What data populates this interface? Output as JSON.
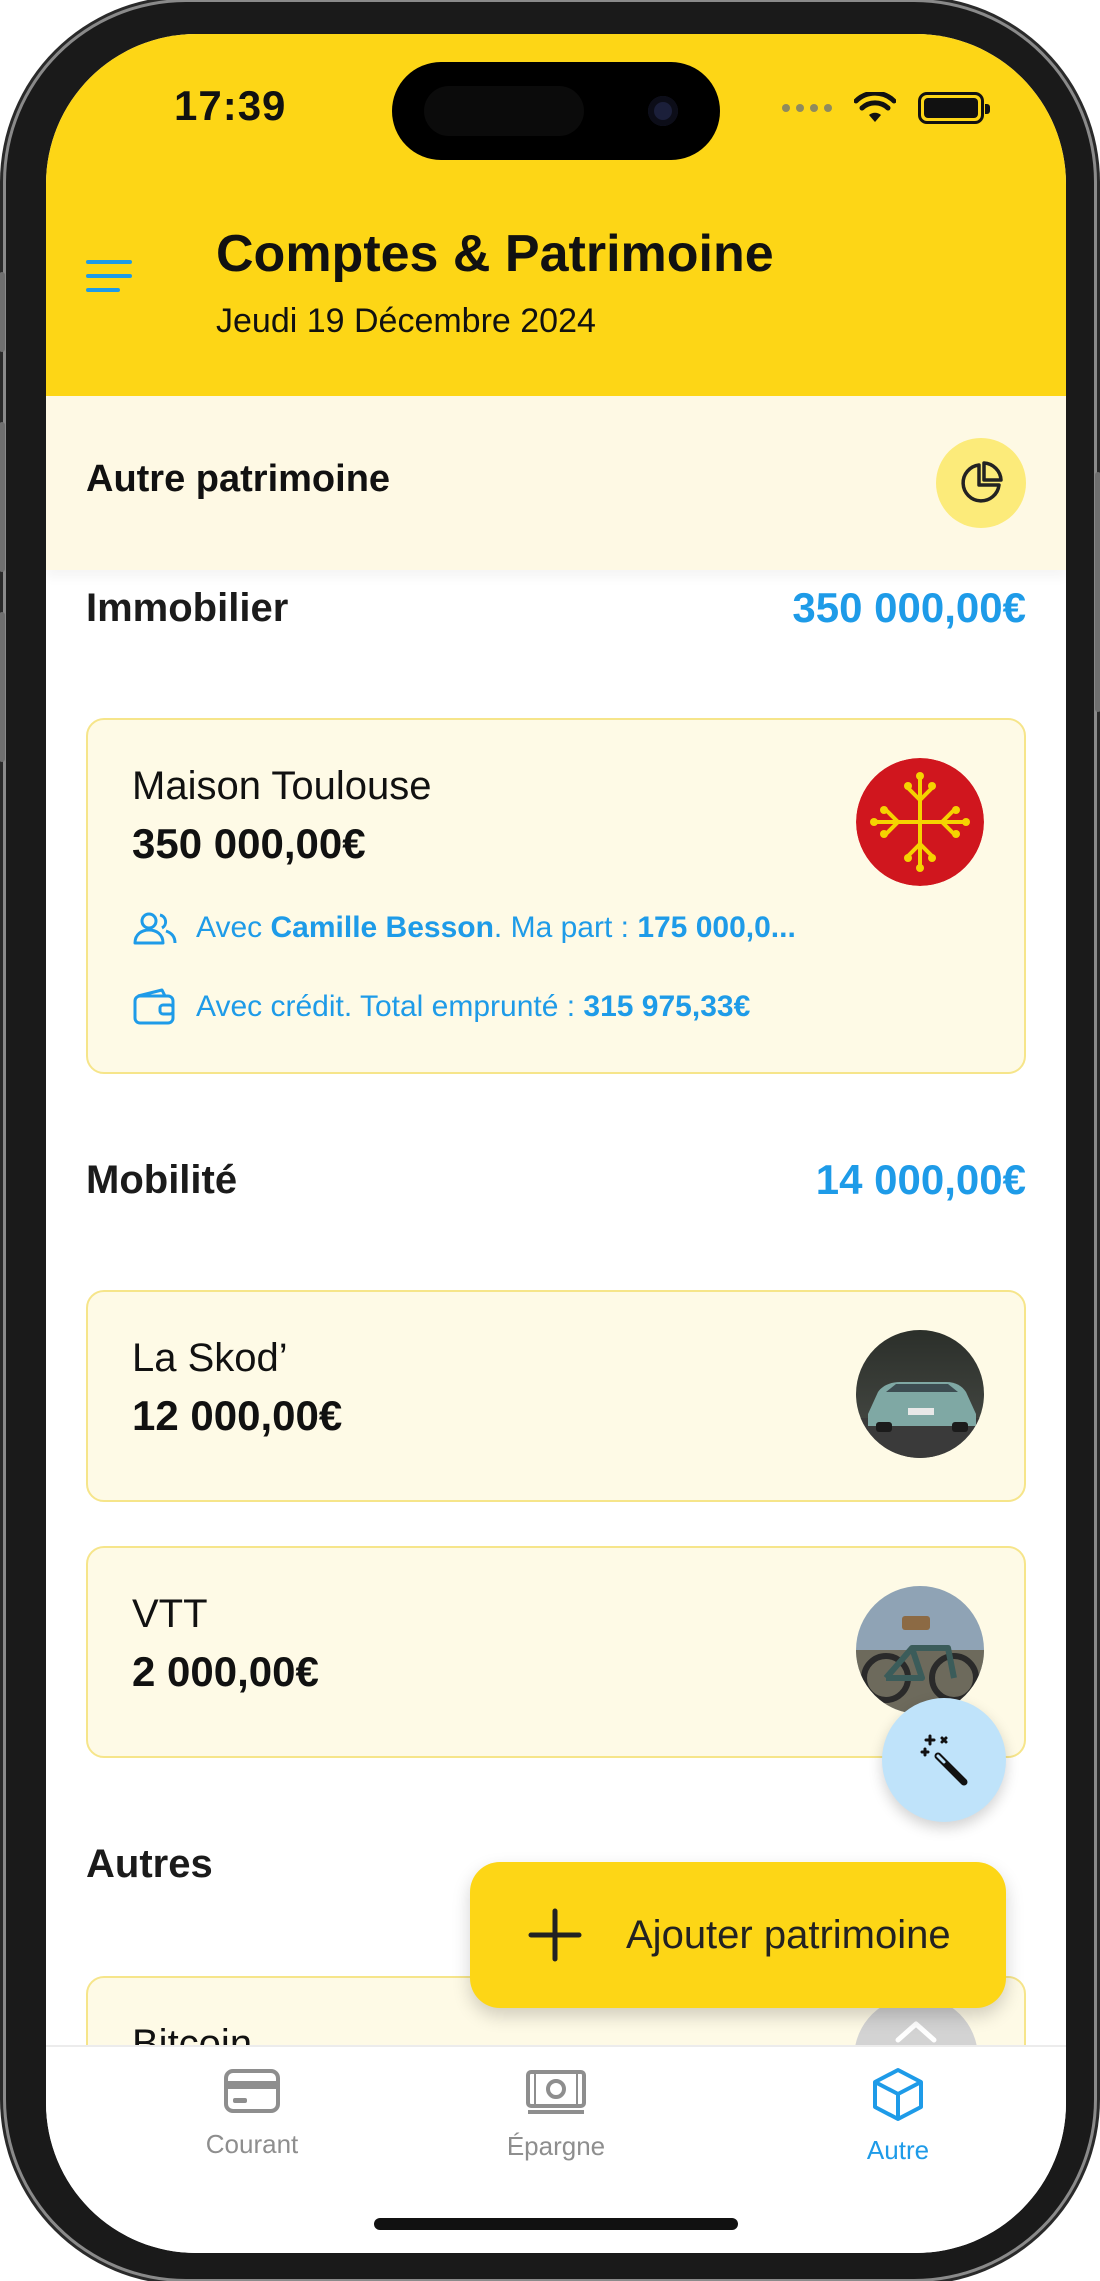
{
  "status_bar": {
    "time": "17:39"
  },
  "header": {
    "title": "Comptes & Patrimoine",
    "date": "Jeudi 19 Décembre 2024"
  },
  "section": {
    "title": "Autre patrimoine"
  },
  "categories": [
    {
      "name": "Immobilier",
      "total": "350 000,00€",
      "items": [
        {
          "name": "Maison Toulouse",
          "value": "350 000,00€",
          "shared_prefix": "Avec ",
          "shared_with": "Camille Besson",
          "share_mid": ". Ma part : ",
          "share_value": "175 000,0...",
          "credit_prefix": "Avec crédit. Total emprunté : ",
          "credit_value": "315 975,33€"
        }
      ]
    },
    {
      "name": "Mobilité",
      "total": "14 000,00€",
      "items": [
        {
          "name": "La Skod’",
          "value": "12 000,00€"
        },
        {
          "name": "VTT",
          "value": "2 000,00€"
        }
      ]
    },
    {
      "name": "Autres",
      "total": "",
      "items": [
        {
          "name": "Bitcoin",
          "value": ""
        }
      ]
    }
  ],
  "actions": {
    "add_label": "Ajouter patrimoine"
  },
  "tabs": [
    {
      "label": "Courant",
      "icon": "card-icon"
    },
    {
      "label": "Épargne",
      "icon": "banknote-icon"
    },
    {
      "label": "Autre",
      "icon": "cube-icon",
      "active": true
    }
  ],
  "colors": {
    "accent_yellow": "#FDD616",
    "accent_blue": "#1E9BE8",
    "card_bg": "#FEFAE6"
  }
}
